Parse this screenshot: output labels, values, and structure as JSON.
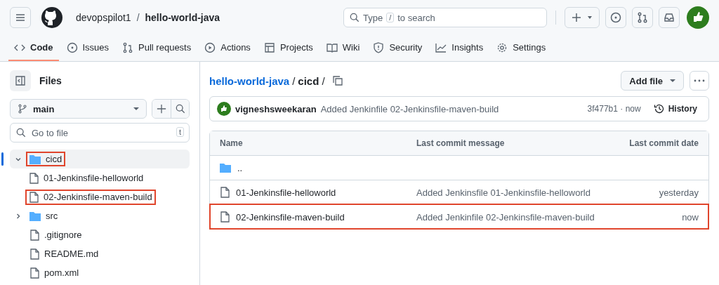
{
  "header": {
    "owner": "devopspilot1",
    "separator": "/",
    "repo": "hello-world-java",
    "search": {
      "before": "Type",
      "key": "/",
      "after": "to search"
    }
  },
  "nav": [
    {
      "label": "Code",
      "selected": true
    },
    {
      "label": "Issues",
      "selected": false
    },
    {
      "label": "Pull requests",
      "selected": false
    },
    {
      "label": "Actions",
      "selected": false
    },
    {
      "label": "Projects",
      "selected": false
    },
    {
      "label": "Wiki",
      "selected": false
    },
    {
      "label": "Security",
      "selected": false
    },
    {
      "label": "Insights",
      "selected": false
    },
    {
      "label": "Settings",
      "selected": false
    }
  ],
  "sidebar": {
    "title": "Files",
    "branch": "main",
    "go_to_file": {
      "placeholder": "Go to file",
      "key": "t"
    },
    "tree": [
      {
        "name": "cicd",
        "kind": "folder",
        "expanded": true,
        "selected": true,
        "highlighted": true,
        "children": [
          {
            "name": "01-Jenkinsfile-helloworld",
            "kind": "file",
            "selected": false,
            "highlighted": false
          },
          {
            "name": "02-Jenkinsfile-maven-build",
            "kind": "file",
            "selected": false,
            "highlighted": true
          }
        ]
      },
      {
        "name": "src",
        "kind": "folder",
        "expanded": false,
        "selected": false,
        "highlighted": false
      },
      {
        "name": ".gitignore",
        "kind": "file",
        "selected": false,
        "highlighted": false
      },
      {
        "name": "README.md",
        "kind": "file",
        "selected": false,
        "highlighted": false
      },
      {
        "name": "pom.xml",
        "kind": "file",
        "selected": false,
        "highlighted": false
      }
    ]
  },
  "breadcrumb": {
    "repo": "hello-world-java",
    "separator": "/",
    "folder": "cicd",
    "trailing": "/"
  },
  "add_file": "Add file",
  "commit": {
    "author": "vigneshsweekaran",
    "message": "Added Jenkinfile 02-Jenkinsfile-maven-build",
    "hash_time": "3f477b1 · now",
    "history": "History"
  },
  "table": {
    "columns": [
      "Name",
      "Last commit message",
      "Last commit date"
    ],
    "rows": [
      {
        "kind": "folder",
        "name": "..",
        "highlighted": false
      },
      {
        "kind": "file",
        "name": "01-Jenkinsfile-helloworld",
        "message": "Added Jenkinsfile 01-Jenkinsfile-helloworld",
        "date": "yesterday",
        "highlighted": false
      },
      {
        "kind": "file",
        "name": "02-Jenkinsfile-maven-build",
        "message": "Added Jenkinfile 02-Jenkinsfile-maven-build",
        "date": "now",
        "highlighted": true
      }
    ]
  }
}
